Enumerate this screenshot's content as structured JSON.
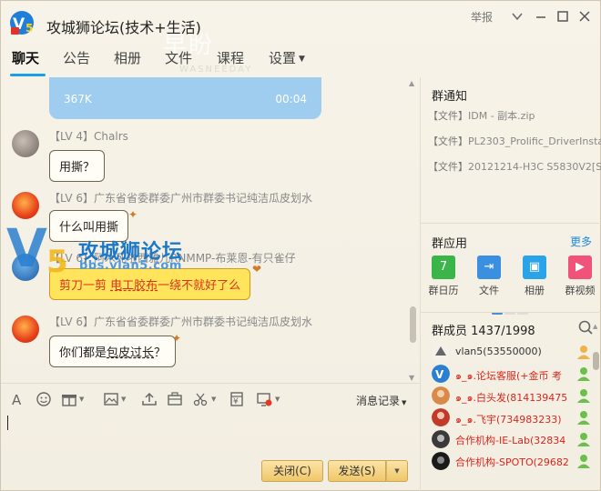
{
  "window": {
    "title": "攻城狮论坛(技术+生活)",
    "report_label": "举报",
    "min_icon": "minimize-icon",
    "max_icon": "maximize-icon",
    "close_icon": "close-icon"
  },
  "tabs": [
    {
      "label": "聊天",
      "active": true
    },
    {
      "label": "公告"
    },
    {
      "label": "相册"
    },
    {
      "label": "文件"
    },
    {
      "label": "课程"
    },
    {
      "label": "设置"
    }
  ],
  "watermark": {
    "faint_top": "早盼",
    "faint_sub": "WASNEEDAY",
    "title": "攻城狮论坛",
    "url": "bbs.vlan5.com"
  },
  "chat": {
    "voice": {
      "size": "367K",
      "duration": "00:04"
    },
    "messages": [
      {
        "sender": "【LV 4】Chalrs",
        "text": "用撕？"
      },
      {
        "sender": "【LV 6】广东省省委群委广州市群委书记纯洁瓜皮划水",
        "text": "什么叫用撕"
      },
      {
        "sender": "【LV 6】阿木死啦西雅儿RNMMP-布莱恩-有只雀仔",
        "text_pre": "剪刀一剪  ",
        "text_link": "电工胶布",
        "text_post": "一绕不就好了么"
      },
      {
        "sender": "【LV 6】广东省省委群委广州市群委书记纯洁瓜皮划水",
        "text_pre": "你们都是",
        "text_link": "包皮过长",
        "text_post": "？"
      }
    ]
  },
  "toolbar": {
    "icons": [
      "font-icon",
      "emoji-icon",
      "gift-icon",
      "image-icon",
      "upload-icon",
      "screenshot-icon",
      "scissors-icon",
      "red-packet-icon",
      "screen-share-icon"
    ],
    "history_label": "消息记录"
  },
  "buttons": {
    "close_label": "关闭(C)",
    "send_label": "发送(S)"
  },
  "right": {
    "notice_title": "群通知",
    "notices": [
      {
        "tag": "【文件】",
        "text": "IDM - 副本.zip"
      },
      {
        "tag": "【文件】",
        "text": "PL2303_Prolific_DriverInstal..."
      },
      {
        "tag": "【文件】",
        "text": "20121214-H3C S5830V2[S58..."
      }
    ],
    "apps_title": "群应用",
    "more_label": "更多",
    "apps": [
      {
        "label": "群日历",
        "icon": "calendar-icon",
        "color": "#3bb54a",
        "glyph": "7"
      },
      {
        "label": "文件",
        "icon": "file-icon",
        "color": "#3a8fe0",
        "glyph": "⇥"
      },
      {
        "label": "相册",
        "icon": "photo-icon",
        "color": "#2aa3e8",
        "glyph": "▣"
      },
      {
        "label": "群视频",
        "icon": "video-icon",
        "color": "#f0527a",
        "glyph": "▶"
      }
    ],
    "members_title": "群成员 1437/1998",
    "members": [
      {
        "name": "vlan5(53550000)",
        "red": false
      },
      {
        "name": "๑_๑.论坛客服(+金币 考",
        "red": true
      },
      {
        "name": "๑_๑.白头发(814139475)",
        "red": true
      },
      {
        "name": "๑_๑.飞宇(734983233)",
        "red": true
      },
      {
        "name": "合作机构-IE-Lab(32834",
        "red": true
      },
      {
        "name": "合作机构-SPOTO(29682",
        "red": true
      }
    ]
  }
}
